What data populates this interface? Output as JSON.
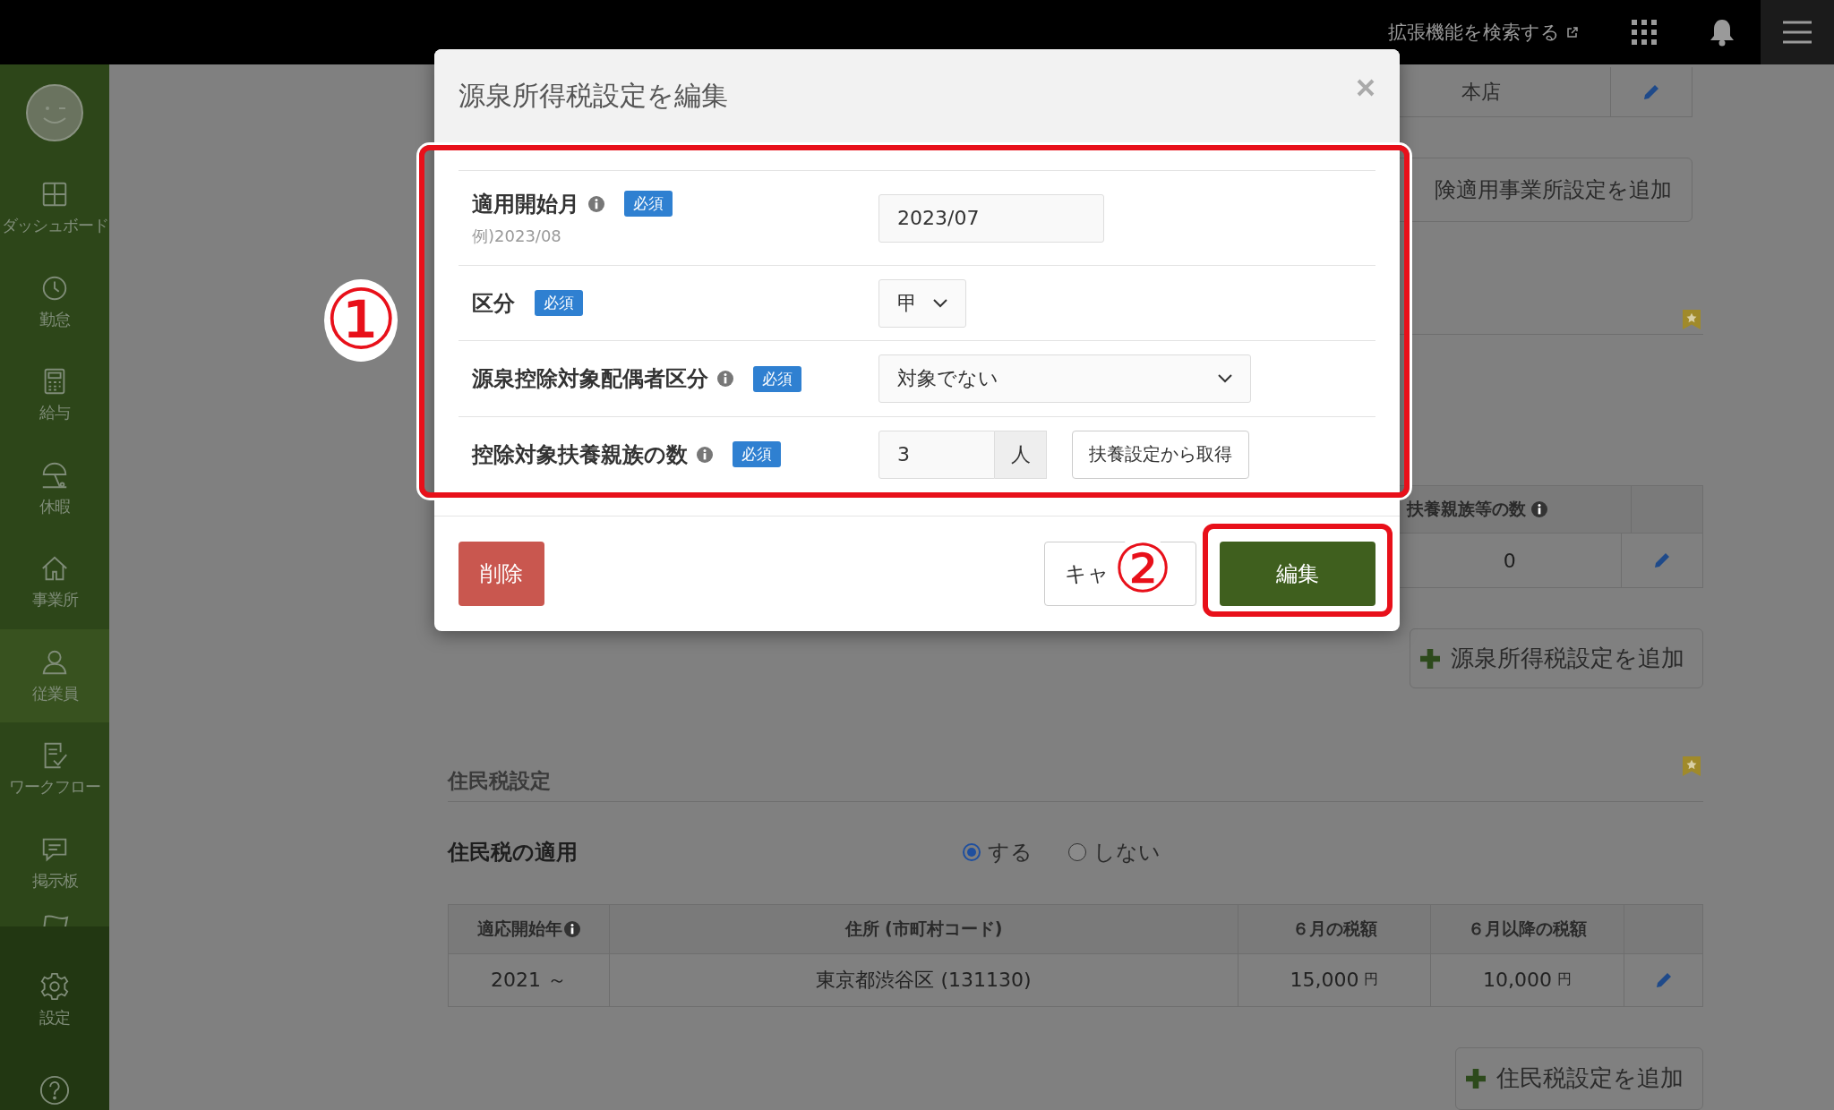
{
  "top_bar": {
    "search_link": "拡張機能を検索する"
  },
  "sidebar": {
    "items": [
      {
        "label": "ダッシュボード",
        "selected": false
      },
      {
        "label": "勤怠",
        "selected": false
      },
      {
        "label": "給与",
        "selected": false
      },
      {
        "label": "休暇",
        "selected": false
      },
      {
        "label": "事業所",
        "selected": false
      },
      {
        "label": "従業員",
        "selected": true
      },
      {
        "label": "ワークフロー",
        "selected": false
      },
      {
        "label": "掲示板",
        "selected": false
      }
    ],
    "settings": "設定"
  },
  "background": {
    "office_table": {
      "cell": "本店"
    },
    "add_insurance_button": "険適用事業所設定を追加",
    "dependents_table": {
      "header": "扶養親族等の数",
      "cell": "0"
    },
    "add_withholding_button": "源泉所得税設定を追加",
    "resident_tax": {
      "title": "住民税設定",
      "apply_label": "住民税の適用",
      "options": [
        {
          "label": "する",
          "selected": true
        },
        {
          "label": "しない",
          "selected": false
        }
      ],
      "table": {
        "columns": [
          "適応開始年",
          "住所 (市町村コード)",
          "６月の税額",
          "６月以降の税額"
        ],
        "rows": [
          {
            "start": "2021 ～",
            "address": "東京都渋谷区 (131130)",
            "june": "15,000",
            "june_unit": "円",
            "after": "10,000",
            "after_unit": "円"
          }
        ]
      },
      "add_button": "住民税設定を追加"
    }
  },
  "modal": {
    "title": "源泉所得税設定を編集",
    "fields": [
      {
        "kind": "text",
        "label": "適用開始月",
        "info": true,
        "required": "必須",
        "hint": "例)2023/08",
        "value": "2023/07"
      },
      {
        "kind": "short_select",
        "label": "区分",
        "info": false,
        "required": "必須",
        "value": "甲"
      },
      {
        "kind": "select",
        "label": "源泉控除対象配偶者区分",
        "info": true,
        "required": "必須",
        "value": "対象でない"
      },
      {
        "kind": "number",
        "label": "控除対象扶養親族の数",
        "info": true,
        "required": "必須",
        "value": "3",
        "unit": "人",
        "action": "扶養設定から取得"
      }
    ],
    "delete_button": "削除",
    "cancel_button": "キャ",
    "submit_button": "編集"
  },
  "annotations": [
    {
      "label": "①"
    },
    {
      "label": "②"
    }
  ]
}
